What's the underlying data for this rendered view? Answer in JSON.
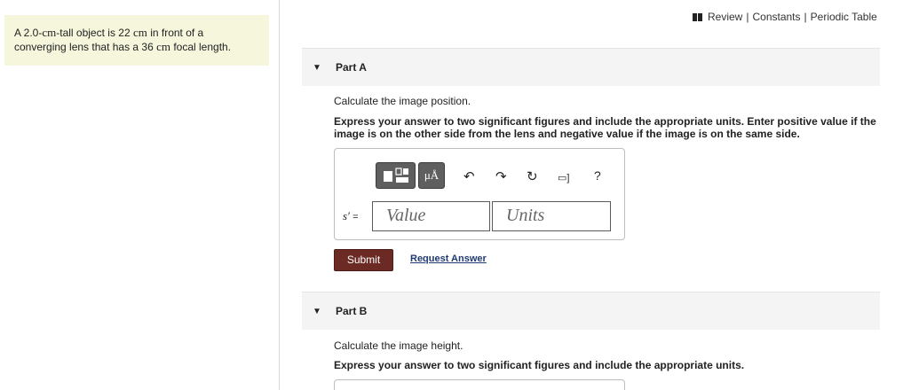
{
  "problem": {
    "text_parts": [
      "A 2.0-",
      "cm",
      "-tall object is 22 ",
      "cm",
      " in front of a converging lens that has a 36 ",
      "cm",
      " focal length."
    ]
  },
  "top_links": {
    "review": "Review",
    "separator": "|",
    "constants": "Constants",
    "periodic_table": "Periodic Table"
  },
  "part_a": {
    "caret": "▼",
    "title": "Part A",
    "question": "Calculate the image position.",
    "instructions": "Express your answer to two significant figures and include the appropriate units. Enter positive value if the image is on the other side from the lens and negative value if the image is on the same side.",
    "toolbar": {
      "units_label": "μÅ",
      "undo": "↶",
      "redo": "↷",
      "reset": "↻",
      "keyboard": "▭]",
      "help": "?"
    },
    "variable_label": "s′",
    "equals": "=",
    "value_placeholder": "Value",
    "units_placeholder": "Units",
    "submit_label": "Submit",
    "request_answer_label": "Request Answer"
  },
  "part_b": {
    "caret": "▼",
    "title": "Part B",
    "question": "Calculate the image height.",
    "instructions": "Express your answer to two significant figures and include the appropriate units."
  }
}
